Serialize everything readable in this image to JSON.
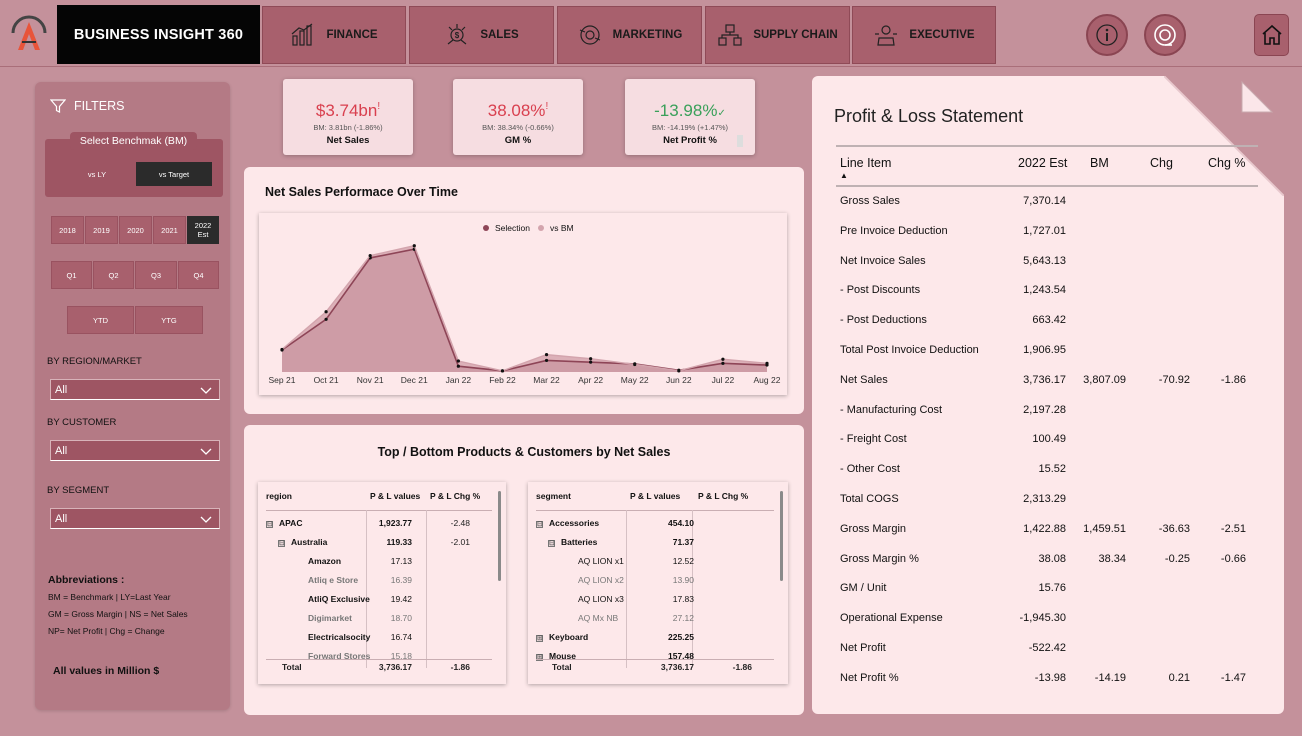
{
  "header": {
    "brand": "BUSINESS INSIGHT 360",
    "nav": [
      {
        "label": "FINANCE",
        "icon": "finance-icon"
      },
      {
        "label": "SALES",
        "icon": "sales-icon"
      },
      {
        "label": "MARKETING",
        "icon": "marketing-icon"
      },
      {
        "label": "SUPPLY CHAIN",
        "icon": "supply-chain-icon"
      },
      {
        "label": "EXECUTIVE",
        "icon": "executive-icon"
      }
    ],
    "icons": [
      "info-icon",
      "support-icon",
      "home-icon"
    ]
  },
  "filters": {
    "title": "FILTERS",
    "benchmark_label": "Select Benchmak (BM)",
    "benchmark_options": [
      "vs LY",
      "vs Target"
    ],
    "benchmark_selected": "vs Target",
    "years": [
      "2018",
      "2019",
      "2020",
      "2021",
      "2022 Est"
    ],
    "year_selected": "2022 Est",
    "quarters": [
      "Q1",
      "Q2",
      "Q3",
      "Q4"
    ],
    "periods": [
      "YTD",
      "YTG"
    ],
    "region_label": "BY REGION/MARKET",
    "region_value": "All",
    "customer_label": "BY CUSTOMER",
    "customer_value": "All",
    "segment_label": "BY SEGMENT",
    "segment_value": "All",
    "abbr_title": "Abbreviations :",
    "abbr_lines": [
      "BM = Benchmark | LY=Last Year",
      "GM = Gross Margin | NS = Net Sales",
      "NP= Net Profit | Chg = Change"
    ],
    "all_values": "All values in Million $"
  },
  "kpis": [
    {
      "value": "$3.74bn",
      "mark": "!",
      "bm": "BM: 3.81bn (-1.86%)",
      "label": "Net Sales",
      "color": "#d9404f"
    },
    {
      "value": "38.08%",
      "mark": "!",
      "bm": "BM: 38.34% (-0.66%)",
      "label": "GM %",
      "color": "#d9404f"
    },
    {
      "value": "-13.98%",
      "mark": "✓",
      "bm": "BM: -14.19% (+1.47%)",
      "label": "Net Profit %",
      "color": "#3aa05a"
    }
  ],
  "chart": {
    "title": "Net Sales Performace Over Time",
    "legend": [
      "Selection",
      "vs BM"
    ]
  },
  "chart_data": {
    "type": "area",
    "categories": [
      "Sep 21",
      "Oct 21",
      "Nov 21",
      "Dec 21",
      "Jan 22",
      "Feb 22",
      "Mar 22",
      "Apr 22",
      "May 22",
      "Jun 22",
      "Jul 22",
      "Aug 22"
    ],
    "series": [
      {
        "name": "Selection",
        "values": [
          190,
          455,
          985,
          1060,
          50,
          10,
          100,
          85,
          70,
          15,
          75,
          60
        ],
        "color": "#8e4557"
      },
      {
        "name": "vs BM",
        "values": [
          195,
          520,
          1005,
          1090,
          95,
          10,
          150,
          115,
          65,
          10,
          110,
          75
        ],
        "color": "#d3a4ad"
      }
    ],
    "ylim": [
      0,
      1200
    ]
  },
  "tables": {
    "title": "Top / Bottom Products & Customers by Net Sales",
    "left": {
      "headers": [
        "region",
        "P & L values",
        "P & L Chg %"
      ],
      "rows": [
        {
          "name": "APAC",
          "val": "1,923.77",
          "chg": "-2.48",
          "level": 0,
          "exp": "⊟"
        },
        {
          "name": "Australia",
          "val": "119.33",
          "chg": "-2.01",
          "level": 1,
          "exp": "⊟"
        },
        {
          "name": "Amazon",
          "val": "17.13",
          "chg": "",
          "level": 2,
          "exp": ""
        },
        {
          "name": "Atliq e Store",
          "val": "16.39",
          "chg": "",
          "level": 2,
          "exp": ""
        },
        {
          "name": "AtliQ Exclusive",
          "val": "19.42",
          "chg": "",
          "level": 2,
          "exp": ""
        },
        {
          "name": "Digimarket",
          "val": "18.70",
          "chg": "",
          "level": 2,
          "exp": ""
        },
        {
          "name": "Electricalsocity",
          "val": "16.74",
          "chg": "",
          "level": 2,
          "exp": ""
        },
        {
          "name": "Forward Stores",
          "val": "15.18",
          "chg": "",
          "level": 2,
          "exp": ""
        }
      ],
      "total": {
        "name": "Total",
        "val": "3,736.17",
        "chg": "-1.86"
      }
    },
    "right": {
      "headers": [
        "segment",
        "P & L values",
        "P & L Chg %"
      ],
      "rows": [
        {
          "name": "Accessories",
          "val": "454.10",
          "chg": "",
          "level": 0,
          "exp": "⊟"
        },
        {
          "name": "Batteries",
          "val": "71.37",
          "chg": "",
          "level": 1,
          "exp": "⊟"
        },
        {
          "name": "AQ LION x1",
          "val": "12.52",
          "chg": "",
          "level": 2,
          "exp": ""
        },
        {
          "name": "AQ LION x2",
          "val": "13.90",
          "chg": "",
          "level": 2,
          "exp": ""
        },
        {
          "name": "AQ LION x3",
          "val": "17.83",
          "chg": "",
          "level": 2,
          "exp": ""
        },
        {
          "name": "AQ Mx NB",
          "val": "27.12",
          "chg": "",
          "level": 2,
          "exp": ""
        },
        {
          "name": "Keyboard",
          "val": "225.25",
          "chg": "",
          "level": 0,
          "exp": "⊞"
        },
        {
          "name": "Mouse",
          "val": "157.48",
          "chg": "",
          "level": 0,
          "exp": "⊞"
        }
      ],
      "total": {
        "name": "Total",
        "val": "3,736.17",
        "chg": "-1.86"
      }
    }
  },
  "pl": {
    "title": "Profit & Loss Statement",
    "headers": [
      "Line Item",
      "2022 Est",
      "BM",
      "Chg",
      "Chg %"
    ],
    "rows": [
      {
        "item": "Gross Sales",
        "est": "7,370.14",
        "bm": "",
        "chg": "",
        "pct": ""
      },
      {
        "item": "Pre Invoice Deduction",
        "est": "1,727.01",
        "bm": "",
        "chg": "",
        "pct": ""
      },
      {
        "item": "Net Invoice Sales",
        "est": "5,643.13",
        "bm": "",
        "chg": "",
        "pct": ""
      },
      {
        "item": "- Post Discounts",
        "est": "1,243.54",
        "bm": "",
        "chg": "",
        "pct": ""
      },
      {
        "item": "- Post Deductions",
        "est": "663.42",
        "bm": "",
        "chg": "",
        "pct": ""
      },
      {
        "item": "Total Post Invoice Deduction",
        "est": "1,906.95",
        "bm": "",
        "chg": "",
        "pct": ""
      },
      {
        "item": "Net Sales",
        "est": "3,736.17",
        "bm": "3,807.09",
        "chg": "-70.92",
        "pct": "-1.86"
      },
      {
        "item": "- Manufacturing Cost",
        "est": "2,197.28",
        "bm": "",
        "chg": "",
        "pct": ""
      },
      {
        "item": "- Freight Cost",
        "est": "100.49",
        "bm": "",
        "chg": "",
        "pct": ""
      },
      {
        "item": "- Other Cost",
        "est": "15.52",
        "bm": "",
        "chg": "",
        "pct": ""
      },
      {
        "item": "Total COGS",
        "est": "2,313.29",
        "bm": "",
        "chg": "",
        "pct": ""
      },
      {
        "item": "Gross Margin",
        "est": "1,422.88",
        "bm": "1,459.51",
        "chg": "-36.63",
        "pct": "-2.51"
      },
      {
        "item": "Gross Margin %",
        "est": "38.08",
        "bm": "38.34",
        "chg": "-0.25",
        "pct": "-0.66"
      },
      {
        "item": "GM / Unit",
        "est": "15.76",
        "bm": "",
        "chg": "",
        "pct": ""
      },
      {
        "item": "Operational Expense",
        "est": "-1,945.30",
        "bm": "",
        "chg": "",
        "pct": ""
      },
      {
        "item": "Net Profit",
        "est": "-522.42",
        "bm": "",
        "chg": "",
        "pct": ""
      },
      {
        "item": "Net Profit %",
        "est": "-13.98",
        "bm": "-14.19",
        "chg": "0.21",
        "pct": "-1.47"
      }
    ]
  }
}
